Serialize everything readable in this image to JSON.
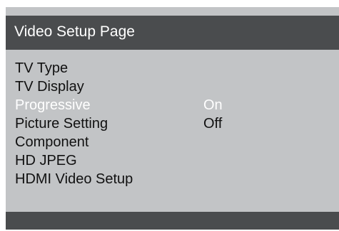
{
  "page": {
    "title": "Video Setup Page"
  },
  "menu": {
    "items": [
      {
        "label": "TV Type",
        "selected": false
      },
      {
        "label": "TV Display",
        "selected": false
      },
      {
        "label": "Progressive",
        "selected": true
      },
      {
        "label": "Picture Setting",
        "selected": false
      },
      {
        "label": "Component",
        "selected": false
      },
      {
        "label": "HD JPEG",
        "selected": false
      },
      {
        "label": "HDMI Video Setup",
        "selected": false
      }
    ]
  },
  "submenu": {
    "parent": "Progressive",
    "options": [
      {
        "label": "On",
        "selected": true
      },
      {
        "label": "Off",
        "selected": false
      }
    ]
  },
  "colors": {
    "panel_background": "#c2c4c6",
    "title_bar": "#4a4c4e",
    "bottom_bar": "#4a4c4e",
    "text": "#111111",
    "highlight_text": "#ffffff"
  }
}
